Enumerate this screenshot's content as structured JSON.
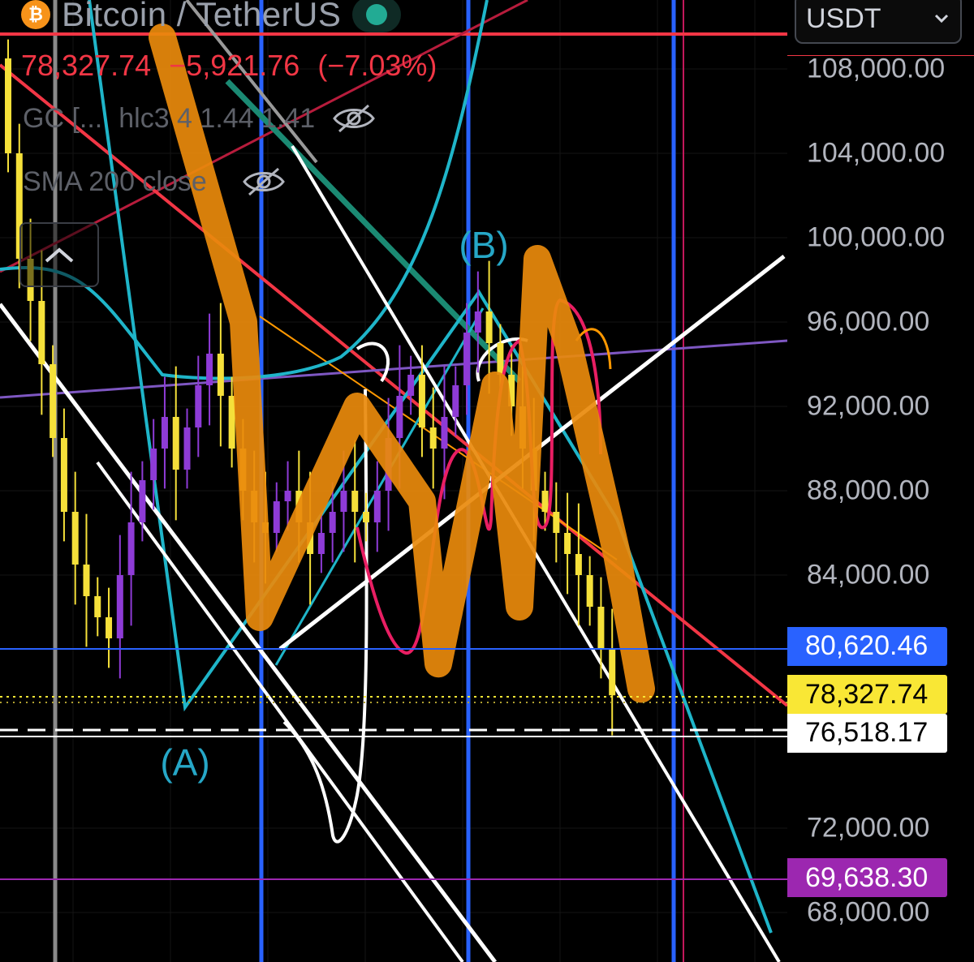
{
  "header": {
    "symbol_icon": "bitcoin-icon",
    "pair_title": "Bitcoin / TetherUS",
    "last_price": "78,327.74",
    "change": "−5,921.76",
    "change_pct": "(−7.03%)",
    "indicator_1": {
      "name": "GC [...",
      "values": "hlc3 4 1.44 1.41"
    },
    "indicator_2": {
      "name": "SMA 200 close"
    }
  },
  "currency_selector": {
    "value": "USDT"
  },
  "price_axis": {
    "ticks": [
      "108,000.00",
      "104,000.00",
      "100,000.00",
      "96,000.00",
      "92,000.00",
      "88,000.00",
      "84,000.00",
      "72,000.00",
      "68,000.00"
    ]
  },
  "price_tags": [
    {
      "label": "80,620.46",
      "value": 80620.46,
      "color": "#2962ff"
    },
    {
      "label": "78,327.74",
      "value": 78327.74,
      "color": "#f9e735"
    },
    {
      "label": "76,518.17",
      "value": 76518.17,
      "color": "#ffffff"
    },
    {
      "label": "69,638.30",
      "value": 69638.3,
      "color": "#9c27b0"
    }
  ],
  "wave_labels": {
    "a": "(A)",
    "b": "(B)"
  },
  "colors": {
    "down": "#f23645",
    "accent": "#2962ff",
    "orange_drawing": "#e98a0c",
    "cyan_line": "#1fb5c9",
    "candle_yellow": "#f5e03a",
    "candle_purple": "#8e3bd6"
  },
  "chart_data": {
    "type": "candlestick",
    "title": "Bitcoin / TetherUS",
    "ylabel": "USDT",
    "ylim": [
      66000,
      110000
    ],
    "last_price": 78327.74,
    "horizontal_levels": [
      80620.46,
      78327.74,
      76518.17,
      69638.3
    ],
    "wave_points": [
      {
        "label": "(A)",
        "price": 77500
      },
      {
        "label": "(B)",
        "price": 97400
      }
    ],
    "drawn_path_prices": [
      109500,
      96000,
      82000,
      92000,
      87500,
      79800,
      93000,
      82500,
      99000,
      95000,
      85000,
      78600
    ],
    "price_trace": [
      108500,
      104000,
      99000,
      97000,
      94000,
      90500,
      87000,
      84500,
      83000,
      82000,
      81000,
      84000,
      86500,
      88500,
      90000,
      91500,
      89000,
      91000,
      93000,
      94500,
      92500,
      90000,
      88000,
      86500,
      86000,
      87500,
      88000,
      86500,
      85000,
      86000,
      87000,
      88000,
      87000,
      86500,
      88000,
      90500,
      92500,
      93500,
      91000,
      90000,
      91500,
      93000,
      95500,
      96500,
      95000,
      93500,
      92000,
      90000,
      88000,
      87000,
      86000,
      85000,
      84000,
      82500,
      80500,
      78300
    ]
  }
}
